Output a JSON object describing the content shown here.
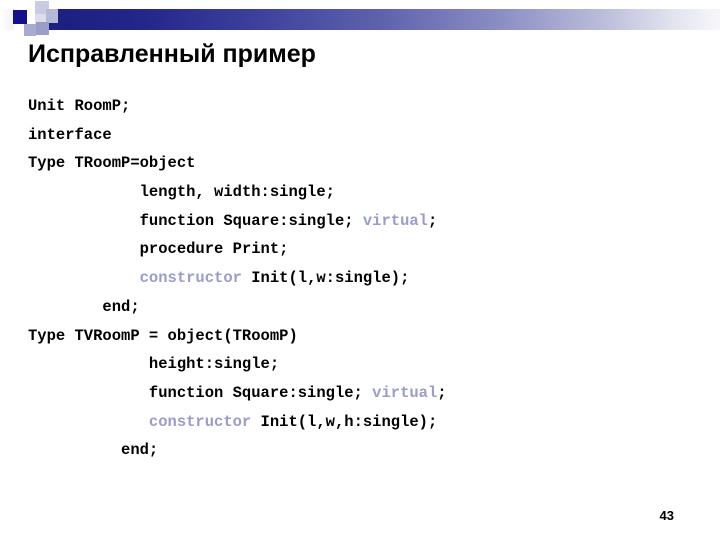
{
  "slide": {
    "title": "Исправленный пример",
    "page_number": "43",
    "accent_color": "#1b1f7e",
    "keyword_color": "#9a9cc9",
    "background_color": "#ffffff"
  },
  "header": {
    "bar_gradient_from": "#1b1f7e",
    "bar_gradient_to": "#f7f7fb",
    "squares": [
      {
        "name": "deco-square-dark",
        "color": "#141089"
      },
      {
        "name": "deco-square-pale-top",
        "color": "#c9cbe2"
      },
      {
        "name": "deco-square-mid",
        "color": "#dcdeeb"
      },
      {
        "name": "deco-square-peri",
        "color": "#a8aad0"
      },
      {
        "name": "deco-square-peri2",
        "color": "#9b9ec9"
      },
      {
        "name": "deco-square-light",
        "color": "#b6b8d8"
      }
    ]
  },
  "code": {
    "lines": [
      {
        "indent": "",
        "segments": [
          {
            "t": "Unit RoomP;",
            "kw": false
          }
        ]
      },
      {
        "indent": "",
        "segments": [
          {
            "t": "interface",
            "kw": false
          }
        ]
      },
      {
        "indent": "",
        "segments": [
          {
            "t": "Type TRoomP=object",
            "kw": false
          }
        ]
      },
      {
        "indent": "            ",
        "segments": [
          {
            "t": "length, width:single;",
            "kw": false
          }
        ]
      },
      {
        "indent": "            ",
        "segments": [
          {
            "t": "function Square:single; ",
            "kw": false
          },
          {
            "t": "virtual",
            "kw": true
          },
          {
            "t": ";",
            "kw": false
          }
        ]
      },
      {
        "indent": "            ",
        "segments": [
          {
            "t": "procedure Print;",
            "kw": false
          }
        ]
      },
      {
        "indent": "            ",
        "segments": [
          {
            "t": "constructor",
            "kw": true
          },
          {
            "t": " Init(l,w:single);",
            "kw": false
          }
        ]
      },
      {
        "indent": "        ",
        "segments": [
          {
            "t": "end;",
            "kw": false
          }
        ]
      },
      {
        "indent": "",
        "segments": [
          {
            "t": "Type TVRoomP = object(TRoomP)",
            "kw": false
          }
        ]
      },
      {
        "indent": "             ",
        "segments": [
          {
            "t": "height:single;",
            "kw": false
          }
        ]
      },
      {
        "indent": "             ",
        "segments": [
          {
            "t": "function Square:single; ",
            "kw": false
          },
          {
            "t": "virtual",
            "kw": true
          },
          {
            "t": ";",
            "kw": false
          }
        ]
      },
      {
        "indent": "             ",
        "segments": [
          {
            "t": "constructor",
            "kw": true
          },
          {
            "t": " Init(l,w,h:single);",
            "kw": false
          }
        ]
      },
      {
        "indent": "          ",
        "segments": [
          {
            "t": "end;",
            "kw": false
          }
        ]
      }
    ]
  }
}
